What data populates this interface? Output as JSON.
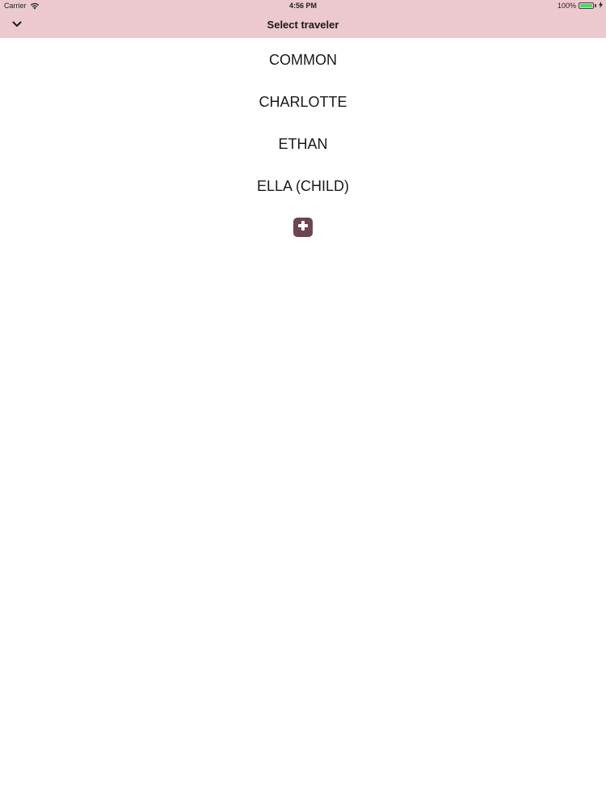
{
  "status_bar": {
    "carrier": "Carrier",
    "time": "4:56 PM",
    "battery": "100%",
    "battery_color": "#4cd964"
  },
  "nav": {
    "title": "Select traveler",
    "collapse_icon": "chevron-down-icon",
    "background": "#ecc8cf"
  },
  "travelers": [
    {
      "label": "COMMON"
    },
    {
      "label": "CHARLOTTE"
    },
    {
      "label": "ETHAN"
    },
    {
      "label": "ELLA (CHILD)"
    }
  ],
  "add_button": {
    "icon": "plus-icon",
    "color": "#6b4650"
  }
}
